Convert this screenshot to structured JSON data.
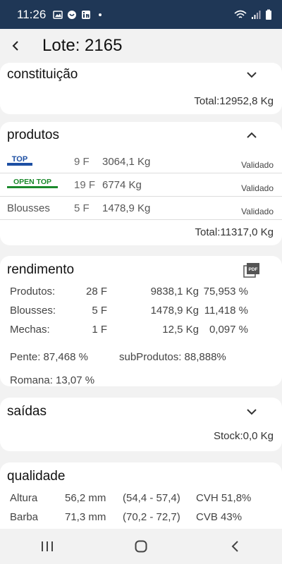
{
  "statusbar": {
    "time": "11:26"
  },
  "header": {
    "title": "Lote: 2165"
  },
  "constituicao": {
    "title": "constituição",
    "total": "Total:12952,8 Kg"
  },
  "produtos": {
    "title": "produtos",
    "rows": [
      {
        "brand": "TOP",
        "f": "9 F",
        "kg": "3064,1 Kg",
        "status": "Validado"
      },
      {
        "brand": "OPEN TOP",
        "f": "19 F",
        "kg": "6774 Kg",
        "status": "Validado"
      },
      {
        "brand": "Blousses",
        "f": "5 F",
        "kg": "1478,9 Kg",
        "status": "Validado"
      }
    ],
    "total": "Total:11317,0 Kg"
  },
  "rendimento": {
    "title": "rendimento",
    "pdf_label": "PDF",
    "rows": [
      {
        "label": "Produtos:",
        "f": "28 F",
        "kg": "9838,1 Kg",
        "pct": "75,953 %"
      },
      {
        "label": "Blousses:",
        "f": "5 F",
        "kg": "1478,9 Kg",
        "pct": "11,418 %"
      },
      {
        "label": "Mechas:",
        "f": "1 F",
        "kg": "12,5 Kg",
        "pct": "0,097 %"
      }
    ],
    "pente": "Pente:  87,468 %",
    "subprodutos": "subProdutos:  88,888%",
    "romana": "Romana:  13,07 %"
  },
  "saidas": {
    "title": "saídas",
    "stock": "Stock:0,0 Kg"
  },
  "qualidade": {
    "title": "qualidade",
    "rows": [
      {
        "label": "Altura",
        "v": "56,2 mm",
        "range": "(54,4 - 57,4)",
        "cv": "CVH 51,8%"
      },
      {
        "label": "Barba",
        "v": "71,3 mm",
        "range": "(70,2 - 72,7)",
        "cv": "CVB 43%"
      }
    ]
  }
}
